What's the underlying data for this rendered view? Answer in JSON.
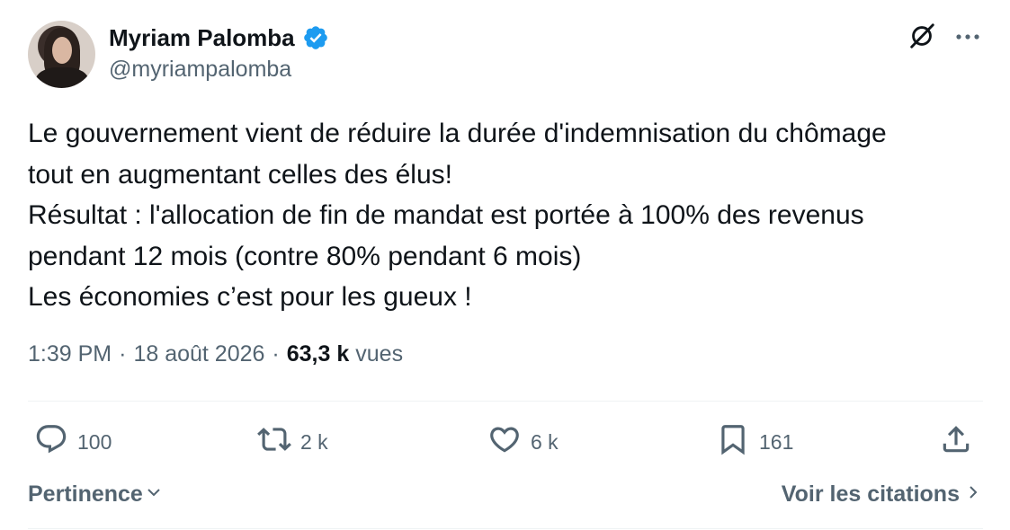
{
  "author": {
    "display_name": "Myriam Palomba",
    "handle": "@myriampalomba",
    "verified": true,
    "verified_color": "#1d9bf0"
  },
  "tweet": {
    "lines": [
      "Le gouvernement vient de réduire la durée d'indemnisation du chômage",
      "tout en augmentant celles des élus!",
      "Résultat : l'allocation de fin de mandat est portée à 100% des revenus",
      "pendant 12 mois (contre 80% pendant 6 mois)",
      "Les économies c’est pour les gueux !"
    ]
  },
  "meta": {
    "time": "1:39 PM",
    "separator": "·",
    "date": "18 août 2026",
    "views_count": "63,3 k",
    "views_label": "vues"
  },
  "actions": {
    "reply_count": "100",
    "retweet_count": "2 k",
    "like_count": "6 k",
    "bookmark_count": "161"
  },
  "footer": {
    "sort_label": "Pertinence",
    "quotes_label": "Voir les citations"
  },
  "icons": {
    "grok": "grok-icon",
    "more": "more-icon",
    "reply": "reply-icon",
    "retweet": "retweet-icon",
    "like": "heart-icon",
    "bookmark": "bookmark-icon",
    "share": "share-icon",
    "chevron_down": "chevron-down-icon",
    "chevron_right": "chevron-right-icon"
  },
  "colors": {
    "text_primary": "#0f1419",
    "text_secondary": "#536471",
    "divider": "#eff3f4"
  }
}
